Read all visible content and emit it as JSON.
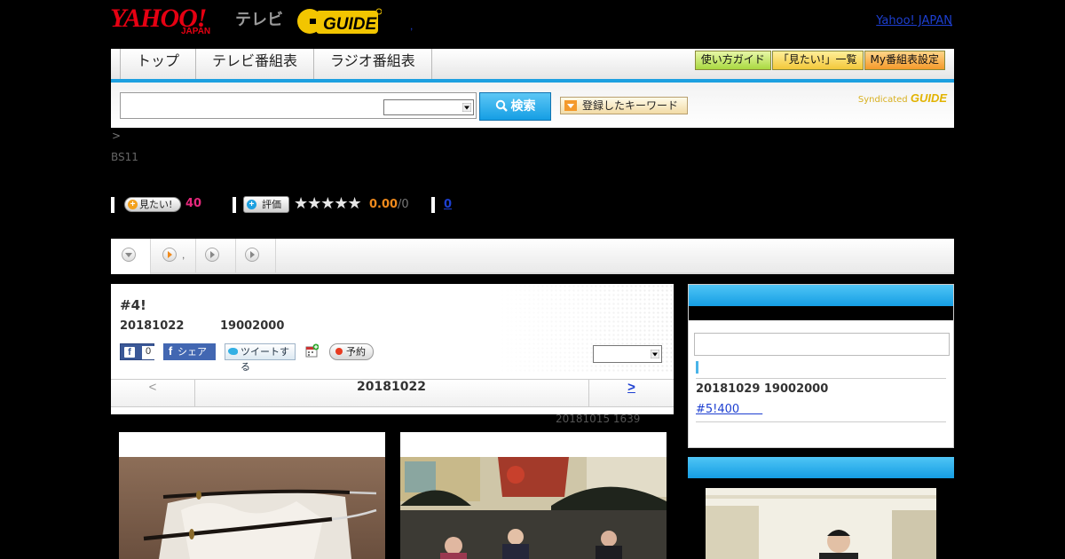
{
  "header": {
    "yahoo_logo": "YAHOO!",
    "yahoo_logo_sub": "JAPAN",
    "tv_label": "テレビ",
    "gguide_logo": "G GUIDE",
    "yahoo_japan_link": "Yahoo! JAPAN",
    "separator": ",",
    "tiny_mark": ","
  },
  "nav": {
    "tabs": [
      "トップ",
      "テレビ番組表",
      "ラジオ番組表"
    ],
    "buttons": [
      "使い方ガイド",
      "「見たい!」一覧",
      "My番組表設定"
    ]
  },
  "search": {
    "button_label": "検索",
    "keyword_button_label": "登録したキーワード",
    "syndicated_label": "Syndicated",
    "syndicated_logo": "GUIDE"
  },
  "breadcrumb": ">",
  "channel": "BS11",
  "stats": {
    "mitai_label": "見たい!",
    "mitai_count": "40",
    "hyoka_label": "評価",
    "stars": "★★★★★",
    "rating": "0.00",
    "rating_total": "/0",
    "comment_count": "0"
  },
  "subtabs": {
    "tab2_label": ","
  },
  "episode": {
    "title": "#4!",
    "date": "20181022",
    "time": "19002000",
    "like_count": "0",
    "share_label": "シェア",
    "tweet_label": "ツイートする",
    "reserve_label": "予約",
    "nav_prev": "<",
    "nav_date": "20181022",
    "nav_next": ">",
    "updated": "20181015  1639"
  },
  "sidebar": {
    "next_date": "20181029  19002000",
    "next_link": "#5!400　　"
  },
  "colors": {
    "accent_blue": "#1da0e0",
    "yahoo_red": "#e60012",
    "link_blue": "#1d3fd1",
    "mitai_pink": "#e6287c",
    "rating_orange": "#f08a1c"
  }
}
